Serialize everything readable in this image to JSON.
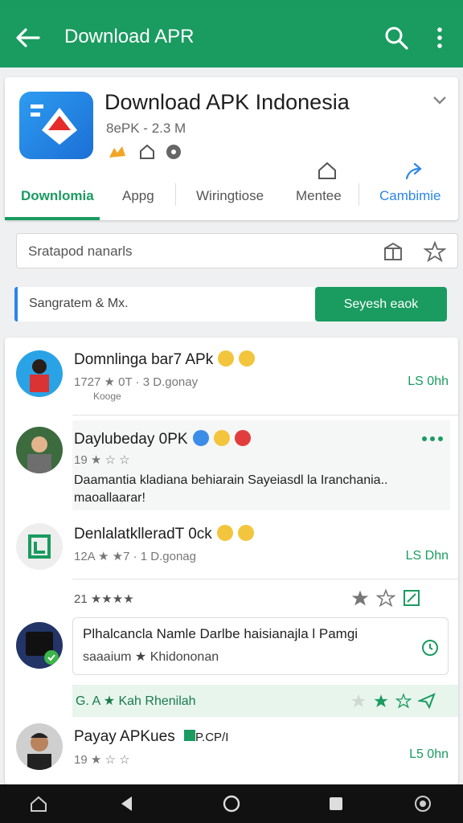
{
  "appbar": {
    "title": "Download APR"
  },
  "app": {
    "name": "Download APK Indonesia",
    "meta": "8ePK - 2.3 M"
  },
  "tabs": [
    {
      "label": "Downlomia"
    },
    {
      "label": "Appg"
    },
    {
      "label": "Wiringtiose"
    },
    {
      "label": "Mentee"
    },
    {
      "label": "Cambimie"
    }
  ],
  "search": {
    "text": "Sratapod nanarls"
  },
  "signup": {
    "field_text": "Sangratem & Mx.",
    "button": "Seyesh eaok"
  },
  "rows": [
    {
      "title": "Domnlinga bar7 APk",
      "sub": "1727 ★ 0T · 3 D.gonay",
      "sub2": "Kooge",
      "size": "LS 0hh"
    },
    {
      "title": "Daylubeday 0PK",
      "sub": "19 ★ ☆ ☆",
      "desc1": "Daamantia kladiana behiarain Sayeiasdl la Iranchania..",
      "desc2": "maoallaarar!"
    },
    {
      "title": "DenlalatklleradT 0ck",
      "sub": "12A ★ ★7 · 1 D.gonag",
      "size": "LS Dhn"
    },
    {
      "rating": "21 ★★★★"
    },
    {
      "promo1": "Plhalcancla Namle Darlbe haisianajla l Pamgi",
      "promo2": "saaaium ★ Khidononan"
    },
    {
      "strip": "G. A ★ Kah Rhenilah"
    },
    {
      "title": "Payay APKues",
      "tag": "P.CP/I",
      "sub": "19 ★ ☆ ☆",
      "size": "L5 0hn"
    }
  ],
  "colors": {
    "primary": "#1a9b60",
    "accent": "#2b86e8"
  }
}
